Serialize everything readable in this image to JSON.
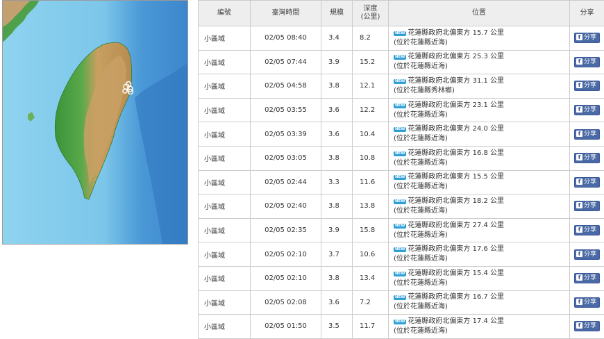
{
  "table": {
    "headers": {
      "code": "編號",
      "time": "臺灣時間",
      "magnitude": "規模",
      "depth_line1": "深度",
      "depth_line2": "(公里)",
      "location": "位置",
      "share": "分享"
    },
    "new_badge": "NEW",
    "share_label": "分享",
    "fb_letter": "f",
    "rows": [
      {
        "code": "小區域",
        "time": "02/05 08:40",
        "mag": "3.4",
        "depth": "8.2",
        "loc1": "花蓮縣政府北偏東方 15.7 公里",
        "loc2": "(位於花蓮縣近海)"
      },
      {
        "code": "小區域",
        "time": "02/05 07:44",
        "mag": "3.9",
        "depth": "15.2",
        "loc1": "花蓮縣政府北偏東方 25.3 公里",
        "loc2": "(位於花蓮縣近海)"
      },
      {
        "code": "小區域",
        "time": "02/05 04:58",
        "mag": "3.8",
        "depth": "12.1",
        "loc1": "花蓮縣政府北偏東方 31.1 公里",
        "loc2": "(位於花蓮縣秀林鄉)"
      },
      {
        "code": "小區域",
        "time": "02/05 03:55",
        "mag": "3.6",
        "depth": "12.2",
        "loc1": "花蓮縣政府北偏東方 23.1 公里",
        "loc2": "(位於花蓮縣近海)"
      },
      {
        "code": "小區域",
        "time": "02/05 03:39",
        "mag": "3.6",
        "depth": "10.4",
        "loc1": "花蓮縣政府北偏東方 24.0 公里",
        "loc2": "(位於花蓮縣近海)"
      },
      {
        "code": "小區域",
        "time": "02/05 03:05",
        "mag": "3.8",
        "depth": "10.8",
        "loc1": "花蓮縣政府北偏東方 16.8 公里",
        "loc2": "(位於花蓮縣近海)"
      },
      {
        "code": "小區域",
        "time": "02/05 02:44",
        "mag": "3.3",
        "depth": "11.6",
        "loc1": "花蓮縣政府北偏東方 15.5 公里",
        "loc2": "(位於花蓮縣近海)"
      },
      {
        "code": "小區域",
        "time": "02/05 02:40",
        "mag": "3.8",
        "depth": "13.8",
        "loc1": "花蓮縣政府北偏東方 18.2 公里",
        "loc2": "(位於花蓮縣近海)"
      },
      {
        "code": "小區域",
        "time": "02/05 02:35",
        "mag": "3.9",
        "depth": "15.8",
        "loc1": "花蓮縣政府北偏東方 27.4 公里",
        "loc2": "(位於花蓮縣近海)"
      },
      {
        "code": "小區域",
        "time": "02/05 02:10",
        "mag": "3.7",
        "depth": "10.6",
        "loc1": "花蓮縣政府北偏東方 17.6 公里",
        "loc2": "(位於花蓮縣近海)"
      },
      {
        "code": "小區域",
        "time": "02/05 02:10",
        "mag": "3.8",
        "depth": "13.4",
        "loc1": "花蓮縣政府北偏東方 15.4 公里",
        "loc2": "(位於花蓮縣近海)"
      },
      {
        "code": "小區域",
        "time": "02/05 02:08",
        "mag": "3.6",
        "depth": "7.2",
        "loc1": "花蓮縣政府北偏東方 16.7 公里",
        "loc2": "(位於花蓮縣近海)"
      },
      {
        "code": "小區域",
        "time": "02/05 01:50",
        "mag": "3.5",
        "depth": "11.7",
        "loc1": "花蓮縣政府北偏東方 17.4 公里",
        "loc2": "(位於花蓮縣近海)"
      }
    ]
  },
  "map": {
    "sea_color": "#8fd0ee",
    "deep_sea_color": "#3f8fd2",
    "lowland_color": "#3f9a3f",
    "mountain_color": "#c9a064",
    "marker_color": "#ffffff"
  }
}
